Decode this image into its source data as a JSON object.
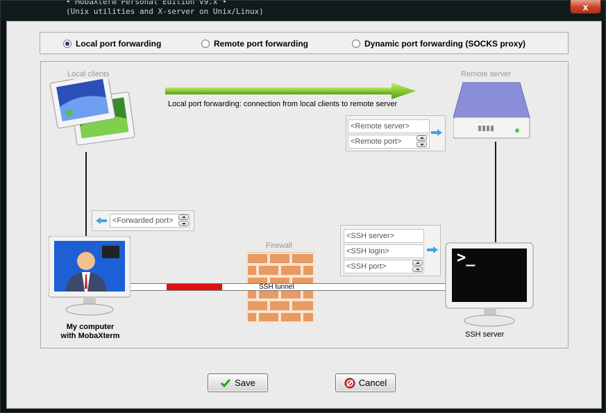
{
  "window": {
    "close_label": "x",
    "terminal_lines": [
      "• MobaXterm Personal Edition v9.x •",
      "  (Unix utilities and X-server on Unix/Linux)"
    ]
  },
  "modes": {
    "local": "Local port forwarding",
    "remote": "Remote port forwarding",
    "dynamic": "Dynamic port forwarding (SOCKS proxy)",
    "selected": "local"
  },
  "diagram": {
    "local_clients_caption": "Local clients",
    "remote_server_caption": "Remote server",
    "direction_text": "Local port forwarding: connection from local clients to remote server",
    "remote_server_placeholder": "<Remote server>",
    "remote_port_placeholder": "<Remote port>",
    "forwarded_port_placeholder": "<Forwarded port>",
    "ssh_server_placeholder": "<SSH server>",
    "ssh_login_placeholder": "<SSH login>",
    "ssh_port_placeholder": "<SSH port>",
    "firewall_caption": "Firewall",
    "tunnel_label": "SSH tunnel",
    "my_computer_label_line1": "My computer",
    "my_computer_label_line2": "with MobaXterm",
    "ssh_server_label": "SSH server",
    "terminal_prompt": ">_"
  },
  "buttons": {
    "save": "Save",
    "cancel": "Cancel"
  },
  "colors": {
    "arrow_green": "#7ecb1e",
    "tunnel_red": "#e01010",
    "blue_arrow": "#3fa3e0"
  }
}
